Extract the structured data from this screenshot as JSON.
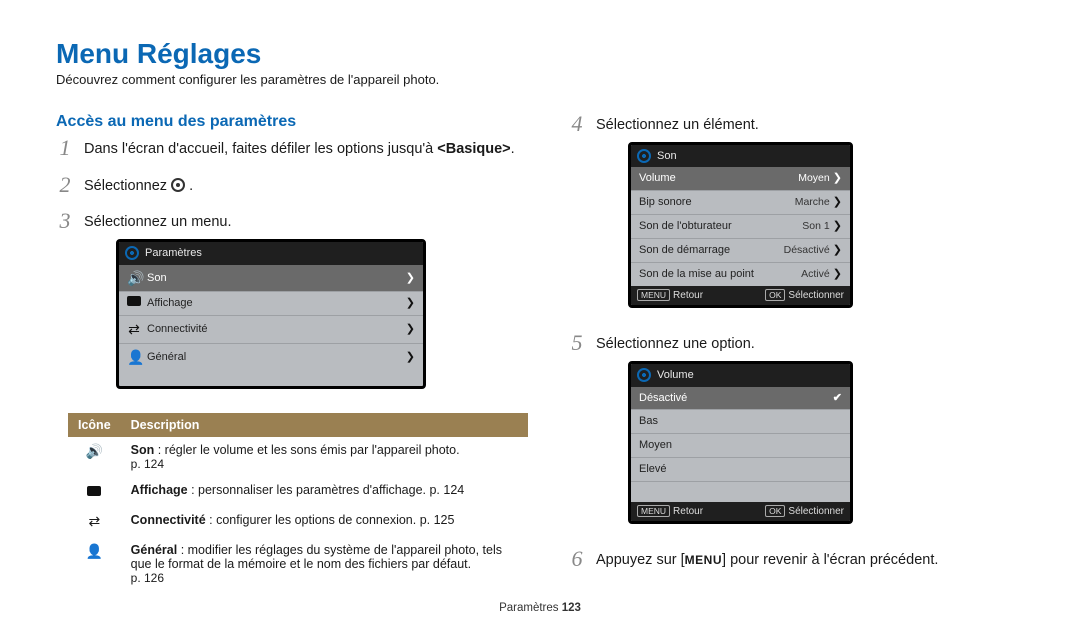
{
  "title": "Menu Réglages",
  "subtitle": "Découvrez comment configurer les paramètres de l'appareil photo.",
  "section_access": "Accès au menu des paramètres",
  "step1_a": "Dans l'écran d'accueil, faites défiler les options jusqu'à ",
  "step1_b": "<Basique>",
  "step1_c": ".",
  "step2": "Sélectionnez ",
  "step2_after": " .",
  "step3": "Sélectionnez un menu.",
  "step4": "Sélectionnez un élément.",
  "step5": "Sélectionnez une option.",
  "step6_a": "Appuyez sur [",
  "step6_menu": "MENU",
  "step6_b": "] pour revenir à l'écran précédent.",
  "panel3": {
    "header": "Paramètres",
    "rows": [
      {
        "label": "Son"
      },
      {
        "label": "Affichage"
      },
      {
        "label": "Connectivité"
      },
      {
        "label": "Général"
      }
    ]
  },
  "panel4": {
    "header": "Son",
    "rows": [
      {
        "label": "Volume",
        "value": "Moyen"
      },
      {
        "label": "Bip sonore",
        "value": "Marche"
      },
      {
        "label": "Son de l'obturateur",
        "value": "Son 1"
      },
      {
        "label": "Son de démarrage",
        "value": "Désactivé"
      },
      {
        "label": "Son de la mise au point",
        "value": "Activé"
      }
    ],
    "footer_back_tag": "MENU",
    "footer_back": "Retour",
    "footer_ok_tag": "OK",
    "footer_ok": "Sélectionner"
  },
  "panel5": {
    "header": "Volume",
    "rows": [
      {
        "label": "Désactivé"
      },
      {
        "label": "Bas"
      },
      {
        "label": "Moyen"
      },
      {
        "label": "Elevé"
      }
    ],
    "footer_back_tag": "MENU",
    "footer_back": "Retour",
    "footer_ok_tag": "OK",
    "footer_ok": "Sélectionner"
  },
  "table": {
    "h_icon": "Icône",
    "h_desc": "Description",
    "rows": [
      {
        "name": "Son",
        "desc": " : régler le volume et les sons émis par l'appareil photo.",
        "page": "p. 124"
      },
      {
        "name": "Affichage",
        "desc": " : personnaliser les paramètres d'affichage. p. 124"
      },
      {
        "name": "Connectivité",
        "desc": " : configurer les options de connexion. p. 125"
      },
      {
        "name": "Général",
        "desc": " : modifier les réglages du système de l'appareil photo, tels que le format de la mémoire et le nom des fichiers par défaut.",
        "page": "p. 126"
      }
    ]
  },
  "footer_cat": "Paramètres  ",
  "footer_page": "123"
}
